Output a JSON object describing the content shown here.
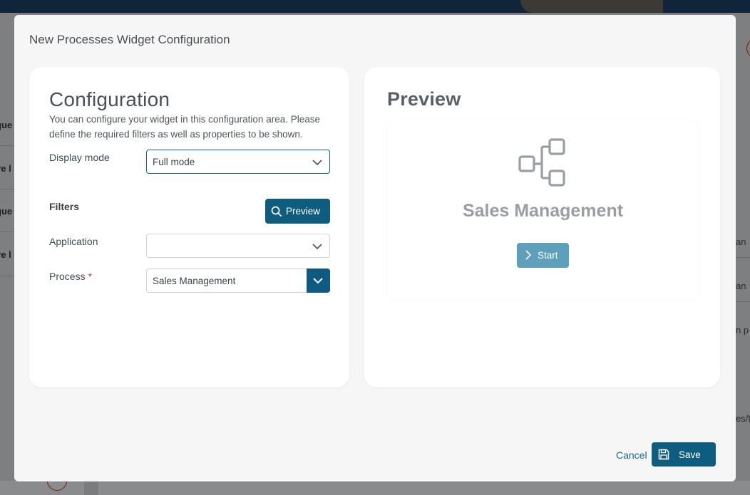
{
  "background": {
    "left_rows": [
      "que",
      "ve l",
      "que",
      "ve l"
    ],
    "right_fragments": [
      "an",
      "an",
      "n p",
      "es/t"
    ]
  },
  "modal": {
    "title": "New Processes Widget Configuration"
  },
  "configuration": {
    "heading": "Configuration",
    "description": "You can configure your widget in this configuration area. Please define the required filters as well as properties to be shown.",
    "display_mode": {
      "label": "Display mode",
      "value": "Full mode"
    },
    "filters_label": "Filters",
    "preview_button": "Preview",
    "application": {
      "label": "Application",
      "value": ""
    },
    "process": {
      "label": "Process",
      "required_mark": "*",
      "value": "Sales Management"
    }
  },
  "preview": {
    "heading": "Preview",
    "process_name": "Sales Management",
    "start_button": "Start"
  },
  "footer": {
    "cancel": "Cancel",
    "save": "Save"
  },
  "colors": {
    "primary": "#0e5d80",
    "start_button": "#5e9fbc",
    "link": "#1b6a8a",
    "required": "#c0392b"
  }
}
